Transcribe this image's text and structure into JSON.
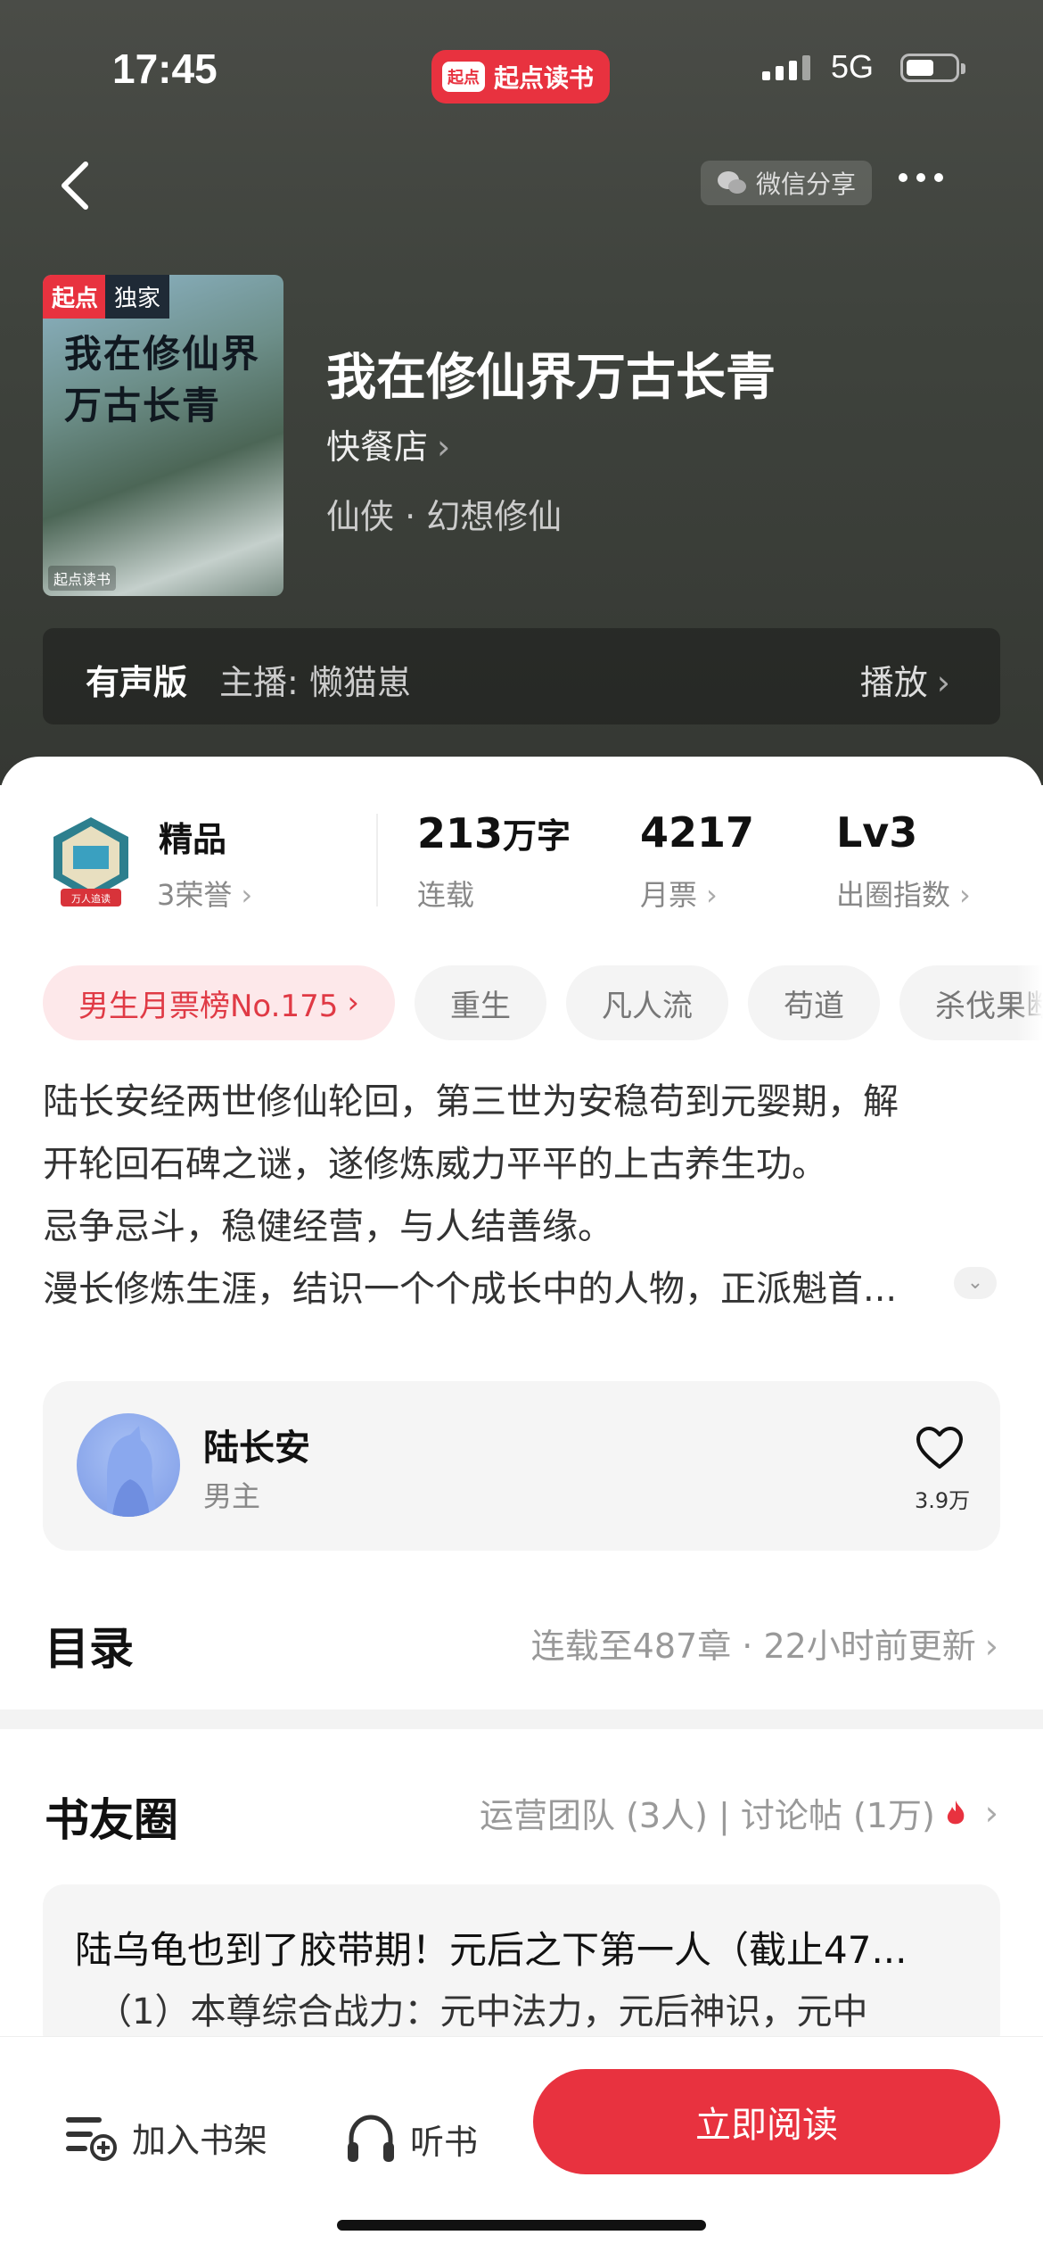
{
  "status_bar": {
    "time": "17:45",
    "network": "5G",
    "app_badge_logo": "起点",
    "app_badge_name": "起点读书"
  },
  "header": {
    "share_label": "微信分享",
    "share_icon": "wechat-icon",
    "more_icon": "more-dots-icon",
    "back_icon": "back-chevron-icon"
  },
  "book": {
    "cover_tag_left": "起点",
    "cover_tag_right": "独家",
    "cover_title_line1": "我在修仙界",
    "cover_title_line2": "万古长青",
    "cover_brand": "起点读书",
    "title": "我在修仙界万古长青",
    "author": "快餐店",
    "genre": "仙侠 · 幻想修仙"
  },
  "audio": {
    "label": "有声版",
    "host": "主播: 懒猫崽",
    "play": "播放"
  },
  "stats": {
    "honor": {
      "title": "精品",
      "sub": "3荣誉",
      "badge_text": "万人追读"
    },
    "words": {
      "value": "213",
      "unit": "万字",
      "sub": "连载"
    },
    "tickets": {
      "value": "4217",
      "sub": "月票"
    },
    "level": {
      "value": "Lv3",
      "sub": "出圈指数"
    }
  },
  "tags": [
    "男生月票榜No.175",
    "重生",
    "凡人流",
    "苟道",
    "杀伐果断"
  ],
  "description": [
    "陆长安经两世修仙轮回，第三世为安稳苟到元婴期，解",
    "开轮回石碑之谜，遂修炼威力平平的上古养生功。",
    "忌争忌斗，稳健经营，与人结善缘。",
    "漫长修炼生涯，结识一个个成长中的人物，正派魁首..."
  ],
  "character": {
    "name": "陆长安",
    "role": "男主",
    "likes": "3.9万"
  },
  "toc": {
    "title": "目录",
    "status": "连载至487章 · 22小时前更新"
  },
  "club": {
    "title": "书友圈",
    "meta": "运营团队 (3人) | 讨论帖 (1万)",
    "post_title": "陆乌龟也到了胶带期！元后之下第一人（截止47...",
    "post_body": "（1）本尊综合战力：元中法力，元后神识，元中"
  },
  "bottom_bar": {
    "add_shelf": "加入书架",
    "listen": "听书",
    "read_now": "立即阅读"
  },
  "colors": {
    "accent": "#e8323f",
    "hero_bg": "#3f433d"
  }
}
